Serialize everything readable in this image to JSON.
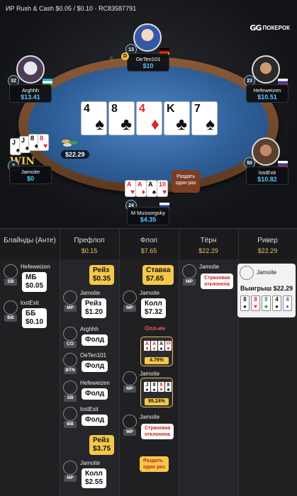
{
  "header": {
    "title": "ИР  Rush & Cash $0.05 / $0.10  · RC83587791"
  },
  "brand": {
    "mark": "GG",
    "name": "ПОКЕРОК"
  },
  "table_text": {
    "rim": "C T Y"
  },
  "players": [
    {
      "name": "OeTen101",
      "stack": "$10",
      "level": "13"
    },
    {
      "name": "Arghhh",
      "stack": "$13.41",
      "level": "32"
    },
    {
      "name": "Hefeweizen",
      "stack": "$10.51",
      "level": "23"
    },
    {
      "name": "Jamoite",
      "stack": "$0",
      "level": "2"
    },
    {
      "name": "lostExit",
      "stack": "$10.82",
      "level": "50"
    },
    {
      "name": "M Mussorgsky",
      "stack": "$4.35",
      "level": "24"
    }
  ],
  "dealer_button": "D",
  "board": [
    {
      "rank": "4",
      "suit": "♠",
      "color": "#111111"
    },
    {
      "rank": "8",
      "suit": "♣",
      "color": "#111111"
    },
    {
      "rank": "4",
      "suit": "♦",
      "color": "#e1262c"
    },
    {
      "rank": "K",
      "suit": "♣",
      "color": "#111111"
    },
    {
      "rank": "7",
      "suit": "♠",
      "color": "#111111"
    }
  ],
  "pot": "$22.29",
  "win_label": "WIN",
  "run_it_button": "Раздать\nодин раз",
  "hole_cards": {
    "jamoite": [
      {
        "rank": "J",
        "suit": "♠"
      },
      {
        "rank": "8",
        "suit": "♠"
      },
      {
        "rank": "8",
        "suit": "♥"
      }
    ],
    "hero": [
      {
        "rank": "A",
        "suit": "♥"
      },
      {
        "rank": "A",
        "suit": "♦"
      },
      {
        "rank": "A",
        "suit": "♠"
      },
      {
        "rank": "10",
        "suit": "♥"
      }
    ]
  },
  "streets": [
    {
      "label": "Блайнды (Анте)",
      "pot": ""
    },
    {
      "label": "Префлоп",
      "pot": "$0.15"
    },
    {
      "label": "Флоп",
      "pot": "$7.65"
    },
    {
      "label": "Тёрн",
      "pot": "$22.29"
    },
    {
      "label": "Ривер",
      "pot": "$22.29"
    }
  ],
  "blinds": [
    {
      "name": "Hefeweizen",
      "pos": "SB",
      "action": "МБ",
      "amount": "$0.05"
    },
    {
      "name": "lostExit",
      "pos": "BB",
      "action": "ББ",
      "amount": "$0.10"
    }
  ],
  "preflop": [
    {
      "name": "",
      "pos": "",
      "action": "Рейз",
      "amount": "$0.35"
    },
    {
      "name": "Jamoite",
      "pos": "MP",
      "action": "Рейз",
      "amount": "$1.20"
    },
    {
      "name": "Arghhh",
      "pos": "CO",
      "action": "Фолд",
      "amount": ""
    },
    {
      "name": "OeTen101",
      "pos": "BTN",
      "action": "Фолд",
      "amount": ""
    },
    {
      "name": "Hefeweizen",
      "pos": "SB",
      "action": "Фолд",
      "amount": ""
    },
    {
      "name": "lostExit",
      "pos": "BB",
      "action": "Фолд",
      "amount": ""
    },
    {
      "name": "",
      "pos": "",
      "action": "Рейз",
      "amount": "$3.75"
    },
    {
      "name": "Jamoite",
      "pos": "MP",
      "action": "Колл",
      "amount": "$2.55"
    }
  ],
  "flop": [
    {
      "name": "",
      "pos": "",
      "action": "Ставка",
      "amount": "$7.65"
    },
    {
      "name": "Jamoite",
      "pos": "MP",
      "action": "Колл",
      "amount": "$7.32"
    },
    {
      "label": "Олл-ин"
    },
    {
      "equity": "4.76%"
    },
    {
      "name": "Jamoite",
      "pos": "MP",
      "equity": "95.24%"
    },
    {
      "name": "Jamoite",
      "pos": "MP",
      "action": "Страховка\nотклонена"
    },
    {
      "action": "Раздать\nодин раз"
    }
  ],
  "turn": [
    {
      "name": "Jamoite",
      "pos": "MP",
      "action": "Страховка\nотклонена"
    }
  ],
  "river": {
    "name": "Jamoite",
    "result": "Выигрыш $22.29",
    "cards": [
      {
        "rank": "8",
        "suit": "♠"
      },
      {
        "rank": "8",
        "suit": "♥"
      },
      {
        "rank": "8",
        "suit": "♣"
      },
      {
        "rank": "4",
        "suit": "♠"
      },
      {
        "rank": "4",
        "suit": "♦"
      }
    ]
  }
}
